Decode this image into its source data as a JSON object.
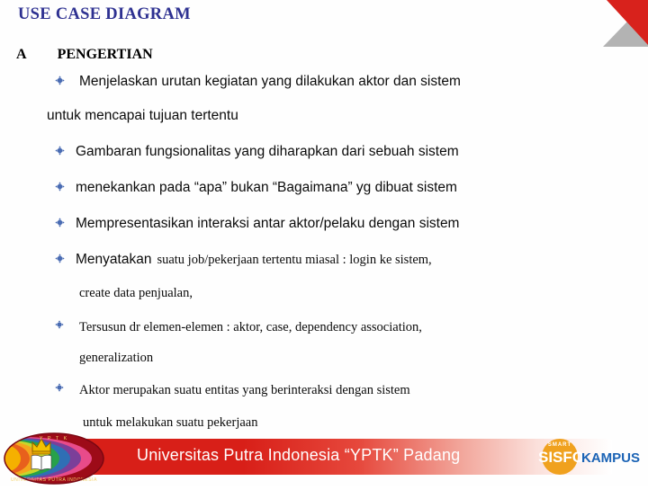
{
  "slide": {
    "title": "USE CASE DIAGRAM",
    "section_letter": "A",
    "section_title": "PENGERTIAN",
    "title_color": "#2e3191",
    "bullet_color": "#4a6cb3",
    "background_color": "#fefefe"
  },
  "bullets": [
    {
      "id": "b1",
      "text": "Menjelaskan urutan kegiatan yang dilakukan aktor dan    sistem",
      "continuation": "untuk mencapai tujuan tertentu",
      "style": "sans"
    },
    {
      "id": "b2",
      "text": "Gambaran fungsionalitas yang diharapkan dari sebuah sistem",
      "style": "sans"
    },
    {
      "id": "b3",
      "text": "menekankan pada “apa” bukan “Bagaimana” yg dibuat sistem",
      "style": "sans"
    },
    {
      "id": "b4",
      "text": "Mempresentasikan interaksi antar aktor/pelaku dengan    sistem",
      "style": "sans"
    },
    {
      "id": "b5",
      "lead": "Menyatakan",
      "text": "suatu job/pekerjaan tertentu miasal : login ke sistem,",
      "continuation": "create data penjualan,",
      "style": "mixed"
    },
    {
      "id": "b6",
      "text": "Tersusun dr elemen-elemen : aktor, case, dependency association,",
      "continuation": "generalization",
      "style": "serif"
    },
    {
      "id": "b7",
      "text": "Aktor merupakan suatu entitas yang berinteraksi dengan sistem",
      "continuation": "untuk  melakukan suatu pekerjaan",
      "style": "serif"
    }
  ],
  "footer": {
    "banner_text": "Universitas Putra Indonesia “YPTK” Padang",
    "banner_color": "#d81f18",
    "university_logo_label": "UNIVERSITAS PUTRA INDONESIA",
    "university_logo_initials": "Y P T K",
    "sisfo_smart": "SMART",
    "sisfo_part1": "SISFO",
    "sisfo_part2": "KAMPUS",
    "sisfo_orange": "#f0a11e",
    "sisfo_blue": "#1b63b5"
  },
  "decoration": {
    "corner_red": "#d8221c",
    "corner_gray": "#b3b3b3"
  }
}
